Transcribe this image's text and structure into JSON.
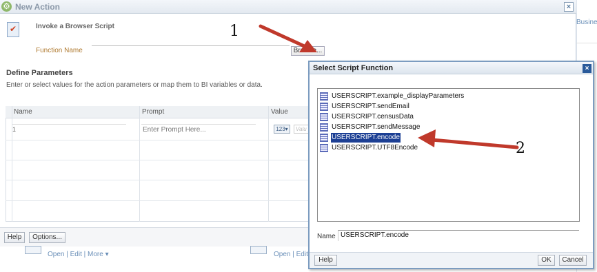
{
  "background": {
    "right_edge_text": "Busine"
  },
  "main_dialog": {
    "title": "New Action",
    "close_glyph": "×",
    "action_type": "Invoke a Browser Script",
    "function_name_label": "Function Name",
    "function_name_value": "",
    "browse_label": "Browse...",
    "define_params_title": "Define Parameters",
    "define_params_desc": "Enter or select values for the action parameters or map them to BI variables or data.",
    "table": {
      "columns": [
        "Name",
        "Prompt",
        "Value"
      ],
      "rows": [
        {
          "name": "1",
          "prompt_placeholder": "Enter Prompt Here...",
          "value_type": "123▾",
          "value_placeholder": "Valu"
        }
      ]
    },
    "footer": {
      "help_label": "Help",
      "options_label": "Options..."
    }
  },
  "background_links": {
    "left": "Open | Edit | More ▾",
    "mid": "Open | Edit | More ▾"
  },
  "annotations": {
    "label_1": "1",
    "label_2": "2",
    "arrow_color": "#c0392b"
  },
  "popup": {
    "title": "Select Script Function",
    "close_glyph": "×",
    "functions": [
      {
        "label": "USERSCRIPT.example_displayParameters",
        "selected": false
      },
      {
        "label": "USERSCRIPT.sendEmail",
        "selected": false
      },
      {
        "label": "USERSCRIPT.censusData",
        "selected": false
      },
      {
        "label": "USERSCRIPT.sendMessage",
        "selected": false
      },
      {
        "label": "USERSCRIPT.encode",
        "selected": true
      },
      {
        "label": "USERSCRIPT.UTF8Encode",
        "selected": false
      }
    ],
    "name_label": "Name",
    "name_value": "USERSCRIPT.encode",
    "help_label": "Help",
    "ok_label": "OK",
    "cancel_label": "Cancel"
  },
  "colors": {
    "selection": "#1c3f94",
    "title_text": "#8a98a8",
    "link": "#6a8fb8",
    "popup_border": "#7c9cc0"
  }
}
